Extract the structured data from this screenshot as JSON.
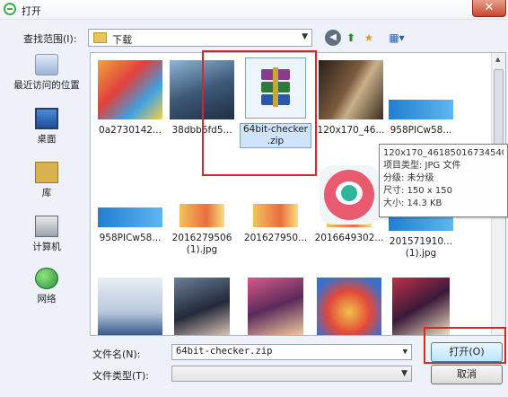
{
  "window": {
    "title": "打开",
    "close_symbol": "✕"
  },
  "toolbar": {
    "lookin_label": "查找范围(I):",
    "lookin_value": "下载",
    "back_icon": "back-arrow-icon",
    "up_icon": "up-folder-icon",
    "new_folder_icon": "new-folder-icon",
    "view_icon": "view-menu-icon"
  },
  "places": [
    {
      "label": "最近访问的位置",
      "icon": "recent-places-icon"
    },
    {
      "label": "桌面",
      "icon": "desktop-icon"
    },
    {
      "label": "库",
      "icon": "library-icon"
    },
    {
      "label": "计算机",
      "icon": "computer-icon"
    },
    {
      "label": "网络",
      "icon": "network-icon"
    }
  ],
  "files": [
    {
      "name": "0a2730142..."
    },
    {
      "name": "38dbb6fd5..."
    },
    {
      "name": "64bit-checker\n.zip",
      "selected": true
    },
    {
      "name": "120x170_46..."
    },
    {
      "name": "958PICw58..."
    },
    {
      "name": "958PICw58..."
    },
    {
      "name": "2016279506\n(1).jpg"
    },
    {
      "name": "201627950..."
    },
    {
      "name": "2016649302..."
    },
    {
      "name": "201571910...\n(1).jpg"
    },
    {
      "name": ""
    },
    {
      "name": ""
    },
    {
      "name": ""
    },
    {
      "name": ""
    },
    {
      "name": ""
    }
  ],
  "tooltip": {
    "line1": "120x170_46185016734540",
    "line2": "项目类型: JPG 文件",
    "line3": "分级: 未分级",
    "line4": "尺寸: 150 x 150",
    "line5": "大小: 14.3 KB"
  },
  "footer": {
    "filename_label": "文件名(N):",
    "filename_value": "64bit-checker.zip",
    "filetype_label": "文件类型(T):",
    "filetype_value": "",
    "open_button": "打开(O)",
    "cancel_button": "取消"
  },
  "colors": {
    "highlight_box": "#d22a2a",
    "selection": "#cfe3fa",
    "window_bg": "#eef2f8"
  }
}
